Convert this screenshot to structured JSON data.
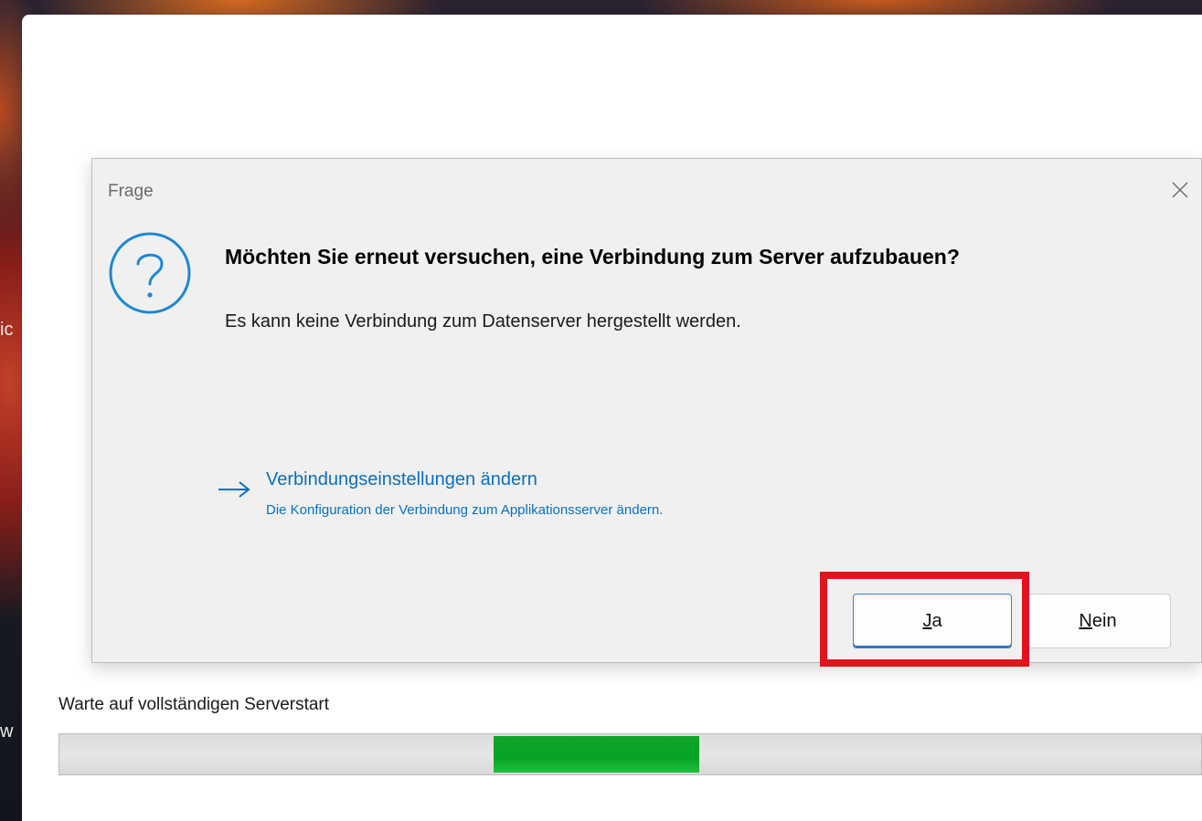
{
  "desktop": {
    "fragment_1": "ic",
    "fragment_2": "",
    "fragment_3": "w"
  },
  "app_window": {
    "status_text": "Warte auf vollständigen Serverstart",
    "progress": {
      "chunk_start_fraction": 0.38,
      "chunk_end_fraction": 0.56,
      "color": "#06a425"
    }
  },
  "dialog": {
    "title": "Frage",
    "close_icon": "close-icon",
    "icon": "question-icon",
    "main_instruction": "Möchten Sie erneut versuchen, eine Verbindung zum Server aufzubauen?",
    "content": "Es kann keine Verbindung zum Datenserver hergestellt werden.",
    "command_link": {
      "icon": "arrow-right-icon",
      "title": "Verbindungseinstellungen ändern",
      "description": "Die Konfiguration der Verbindung zum Applikationsserver ändern."
    },
    "buttons": {
      "yes_mnemonic": "J",
      "yes_rest": "a",
      "no_mnemonic": "N",
      "no_rest": "ein"
    }
  },
  "colors": {
    "link": "#0a6fc2",
    "highlight": "#e0141e",
    "icon": "#1e88d2"
  }
}
